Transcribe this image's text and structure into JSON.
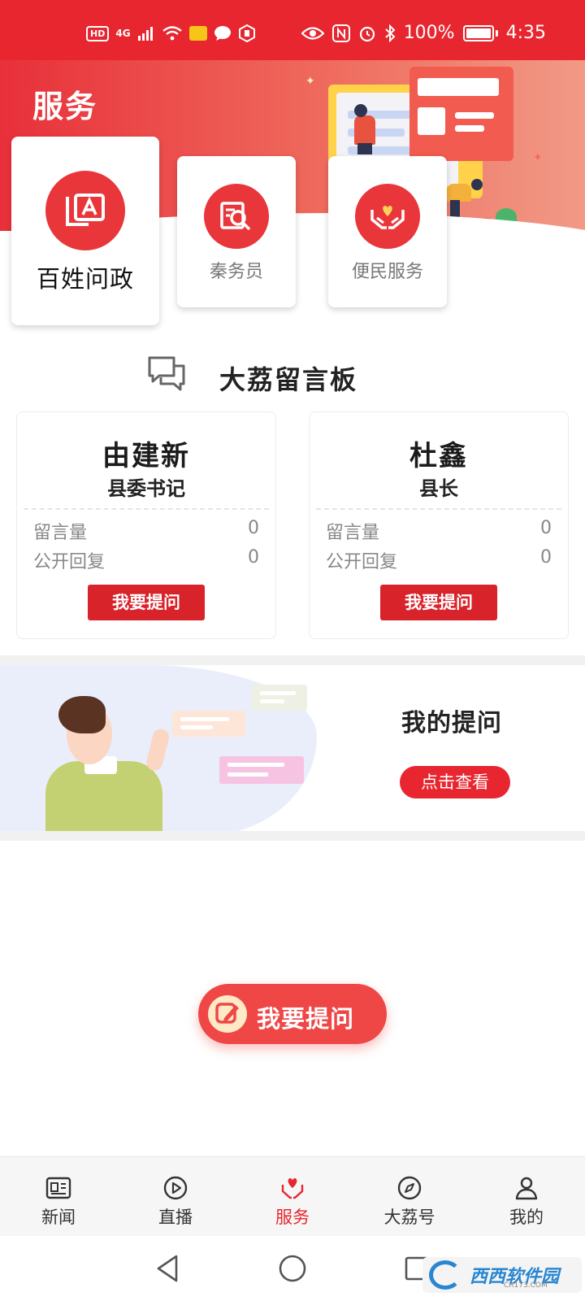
{
  "status_bar": {
    "left_badges": [
      "HD",
      "4G"
    ],
    "battery_text": "100%",
    "time": "4:35"
  },
  "header": {
    "title": "服务"
  },
  "services": [
    {
      "label": "百姓问政",
      "icon": "qa-board-icon"
    },
    {
      "label": "秦务员",
      "icon": "document-search-icon"
    },
    {
      "label": "便民服务",
      "icon": "heart-hands-icon"
    }
  ],
  "message_board": {
    "title": "大荔留言板",
    "officials": [
      {
        "name": "由建新",
        "title": "县委书记",
        "messages_label": "留言量",
        "messages": "0",
        "replies_label": "公开回复",
        "replies": "0",
        "ask_label": "我要提问"
      },
      {
        "name": "杜鑫",
        "title": "县长",
        "messages_label": "留言量",
        "messages": "0",
        "replies_label": "公开回复",
        "replies": "0",
        "ask_label": "我要提问"
      }
    ]
  },
  "my_questions": {
    "title": "我的提问",
    "button": "点击查看"
  },
  "fab": {
    "label": "我要提问"
  },
  "tabs": [
    {
      "label": "新闻",
      "icon": "news-icon"
    },
    {
      "label": "直播",
      "icon": "play-icon"
    },
    {
      "label": "服务",
      "icon": "service-heart-icon",
      "active": true
    },
    {
      "label": "大荔号",
      "icon": "compass-icon"
    },
    {
      "label": "我的",
      "icon": "user-icon"
    }
  ],
  "watermark": {
    "text": "西西软件园",
    "sub": "CR173.COM"
  },
  "colors": {
    "primary": "#e8262f",
    "fab": "#ef4746"
  }
}
